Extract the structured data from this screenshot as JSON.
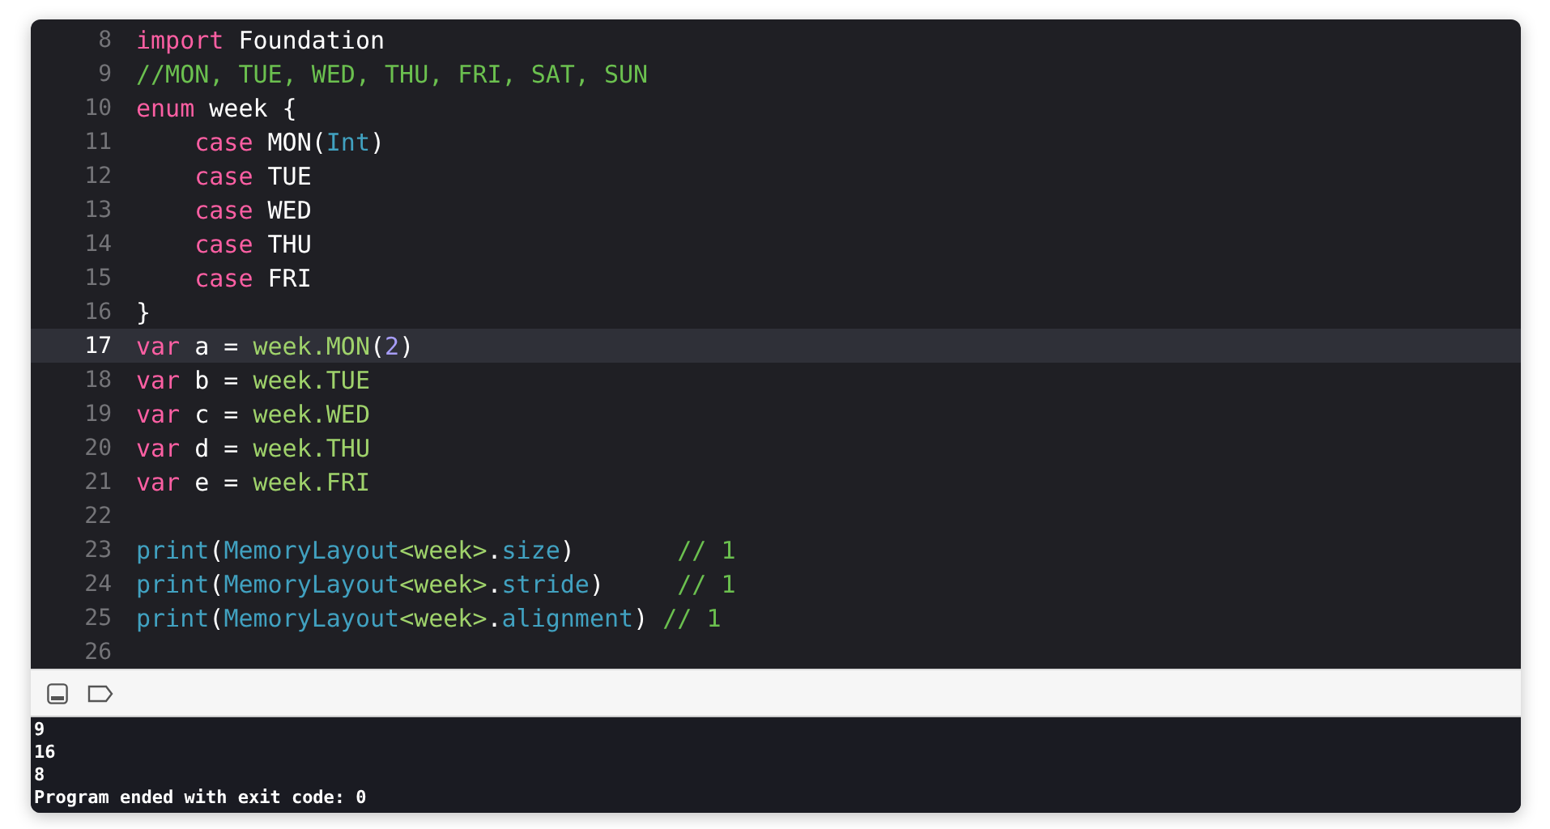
{
  "editor": {
    "lines": [
      {
        "number": "8",
        "current": false,
        "tokens": [
          {
            "kind": "keyword",
            "text": "import"
          },
          {
            "kind": "plain",
            "text": " Foundation"
          }
        ]
      },
      {
        "number": "9",
        "current": false,
        "tokens": [
          {
            "kind": "comment",
            "text": "//MON, TUE, WED, THU, FRI, SAT, SUN"
          }
        ]
      },
      {
        "number": "10",
        "current": false,
        "tokens": [
          {
            "kind": "keyword",
            "text": "enum"
          },
          {
            "kind": "plain",
            "text": " week {"
          }
        ]
      },
      {
        "number": "11",
        "current": false,
        "indented": true,
        "tokens": [
          {
            "kind": "keyword",
            "text": "case"
          },
          {
            "kind": "plain",
            "text": " MON("
          },
          {
            "kind": "type",
            "text": "Int"
          },
          {
            "kind": "plain",
            "text": ")"
          }
        ]
      },
      {
        "number": "12",
        "current": false,
        "indented": true,
        "tokens": [
          {
            "kind": "keyword",
            "text": "case"
          },
          {
            "kind": "plain",
            "text": " TUE"
          }
        ]
      },
      {
        "number": "13",
        "current": false,
        "indented": true,
        "tokens": [
          {
            "kind": "keyword",
            "text": "case"
          },
          {
            "kind": "plain",
            "text": " WED"
          }
        ]
      },
      {
        "number": "14",
        "current": false,
        "indented": true,
        "tokens": [
          {
            "kind": "keyword",
            "text": "case"
          },
          {
            "kind": "plain",
            "text": " THU"
          }
        ]
      },
      {
        "number": "15",
        "current": false,
        "indented": true,
        "tokens": [
          {
            "kind": "keyword",
            "text": "case"
          },
          {
            "kind": "plain",
            "text": " FRI"
          }
        ]
      },
      {
        "number": "16",
        "current": false,
        "tokens": [
          {
            "kind": "plain",
            "text": "}"
          }
        ]
      },
      {
        "number": "17",
        "current": true,
        "tokens": [
          {
            "kind": "keyword",
            "text": "var"
          },
          {
            "kind": "plain",
            "text": " a = "
          },
          {
            "kind": "project",
            "text": "week.MON"
          },
          {
            "kind": "plain",
            "text": "("
          },
          {
            "kind": "number",
            "text": "2"
          },
          {
            "kind": "plain",
            "text": ")"
          }
        ]
      },
      {
        "number": "18",
        "current": false,
        "tokens": [
          {
            "kind": "keyword",
            "text": "var"
          },
          {
            "kind": "plain",
            "text": " b = "
          },
          {
            "kind": "project",
            "text": "week.TUE"
          }
        ]
      },
      {
        "number": "19",
        "current": false,
        "tokens": [
          {
            "kind": "keyword",
            "text": "var"
          },
          {
            "kind": "plain",
            "text": " c = "
          },
          {
            "kind": "project",
            "text": "week.WED"
          }
        ]
      },
      {
        "number": "20",
        "current": false,
        "tokens": [
          {
            "kind": "keyword",
            "text": "var"
          },
          {
            "kind": "plain",
            "text": " d = "
          },
          {
            "kind": "project",
            "text": "week.THU"
          }
        ]
      },
      {
        "number": "21",
        "current": false,
        "tokens": [
          {
            "kind": "keyword",
            "text": "var"
          },
          {
            "kind": "plain",
            "text": " e = "
          },
          {
            "kind": "project",
            "text": "week.FRI"
          }
        ]
      },
      {
        "number": "22",
        "current": false
      },
      {
        "number": "23",
        "current": false,
        "tokens": [
          {
            "kind": "type",
            "text": "print"
          },
          {
            "kind": "plain",
            "text": "("
          },
          {
            "kind": "type",
            "text": "MemoryLayout"
          },
          {
            "kind": "project",
            "text": "<week>"
          },
          {
            "kind": "plain",
            "text": "."
          },
          {
            "kind": "type",
            "text": "size"
          },
          {
            "kind": "plain",
            "text": ")       "
          },
          {
            "kind": "comment",
            "text": "// 1"
          }
        ]
      },
      {
        "number": "24",
        "current": false,
        "tokens": [
          {
            "kind": "type",
            "text": "print"
          },
          {
            "kind": "plain",
            "text": "("
          },
          {
            "kind": "type",
            "text": "MemoryLayout"
          },
          {
            "kind": "project",
            "text": "<week>"
          },
          {
            "kind": "plain",
            "text": "."
          },
          {
            "kind": "type",
            "text": "stride"
          },
          {
            "kind": "plain",
            "text": ")     "
          },
          {
            "kind": "comment",
            "text": "// 1"
          }
        ]
      },
      {
        "number": "25",
        "current": false,
        "tokens": [
          {
            "kind": "type",
            "text": "print"
          },
          {
            "kind": "plain",
            "text": "("
          },
          {
            "kind": "type",
            "text": "MemoryLayout"
          },
          {
            "kind": "project",
            "text": "<week>"
          },
          {
            "kind": "plain",
            "text": "."
          },
          {
            "kind": "type",
            "text": "alignment"
          },
          {
            "kind": "plain",
            "text": ") "
          },
          {
            "kind": "comment",
            "text": "// 1"
          }
        ]
      },
      {
        "number": "26",
        "current": false
      }
    ]
  },
  "console": {
    "output": [
      "9",
      "16",
      "8",
      "Program ended with exit code: 0"
    ]
  }
}
